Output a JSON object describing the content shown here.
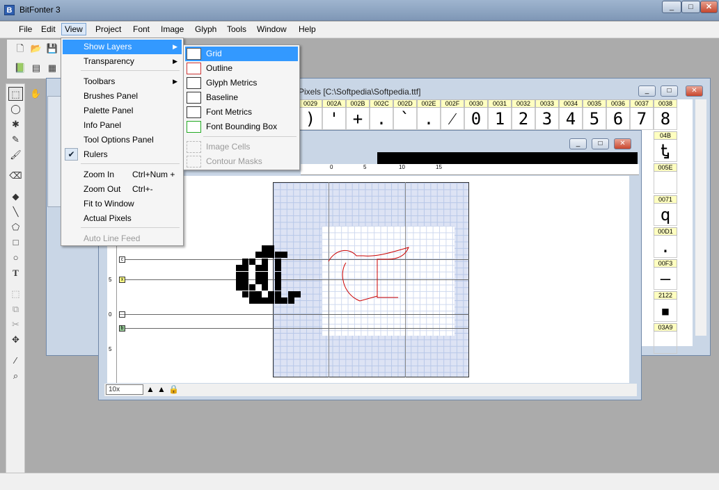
{
  "app": {
    "title": "BitFonter 3",
    "icon": "B"
  },
  "window_controls": {
    "minimize": "_",
    "maximize": "□",
    "close": "✕"
  },
  "menubar": [
    "File",
    "Edit",
    "View",
    "Project",
    "Font",
    "Image",
    "Glyph",
    "Tools",
    "Window",
    "Help"
  ],
  "view_menu": {
    "items": [
      {
        "label": "Show Layers",
        "submenu": true,
        "highlight": true
      },
      {
        "label": "Transparency",
        "submenu": true
      },
      {
        "label": "Toolbars",
        "submenu": true
      },
      {
        "label": "Brushes Panel"
      },
      {
        "label": "Palette Panel"
      },
      {
        "label": "Info Panel"
      },
      {
        "label": "Tool Options Panel"
      },
      {
        "label": "Rulers",
        "checked": true
      },
      {
        "label": "Zoom In",
        "shortcut": "Ctrl+Num +"
      },
      {
        "label": "Zoom Out",
        "shortcut": "Ctrl+-"
      },
      {
        "label": "Fit to Window"
      },
      {
        "label": "Actual Pixels"
      },
      {
        "label": "Auto Line Feed",
        "disabled": true
      }
    ]
  },
  "layers_menu": {
    "items": [
      {
        "label": "Grid",
        "highlight": true
      },
      {
        "label": "Outline"
      },
      {
        "label": "Glyph Metrics"
      },
      {
        "label": "Baseline"
      },
      {
        "label": "Font Metrics"
      },
      {
        "label": "Font Bounding Box"
      },
      {
        "label": "Image Cells",
        "disabled": true
      },
      {
        "label": "Contour Masks",
        "disabled": true
      }
    ]
  },
  "font_window": {
    "title": "Pixels [C:\\Softpedia\\Softpedia.ttf]",
    "codes": [
      "0029",
      "002A",
      "002B",
      "002C",
      "002D",
      "002E",
      "002F",
      "0030",
      "0031",
      "0032",
      "0033",
      "0034",
      "0035",
      "0036",
      "0037",
      "0038"
    ],
    "glyphs": [
      ")",
      "'",
      "+",
      ".",
      "`",
      ".",
      "⁄",
      "0",
      "1",
      "2",
      "3",
      "4",
      "5",
      "6",
      "7",
      "8"
    ],
    "side_codes": [
      "04B",
      "005E",
      "0071",
      "00D1",
      "00F3",
      "2122",
      "03A9"
    ],
    "side_glyphs": [
      "Ꮏ",
      "",
      "q",
      ".",
      "—",
      "▪",
      ""
    ]
  },
  "editor": {
    "zoom": "10x",
    "ruler_marks": [
      "0",
      "5",
      "10",
      "15"
    ],
    "side_marks": [
      "5",
      "0",
      "5"
    ],
    "marker_labels": [
      "c",
      "x",
      "—",
      "b"
    ]
  }
}
